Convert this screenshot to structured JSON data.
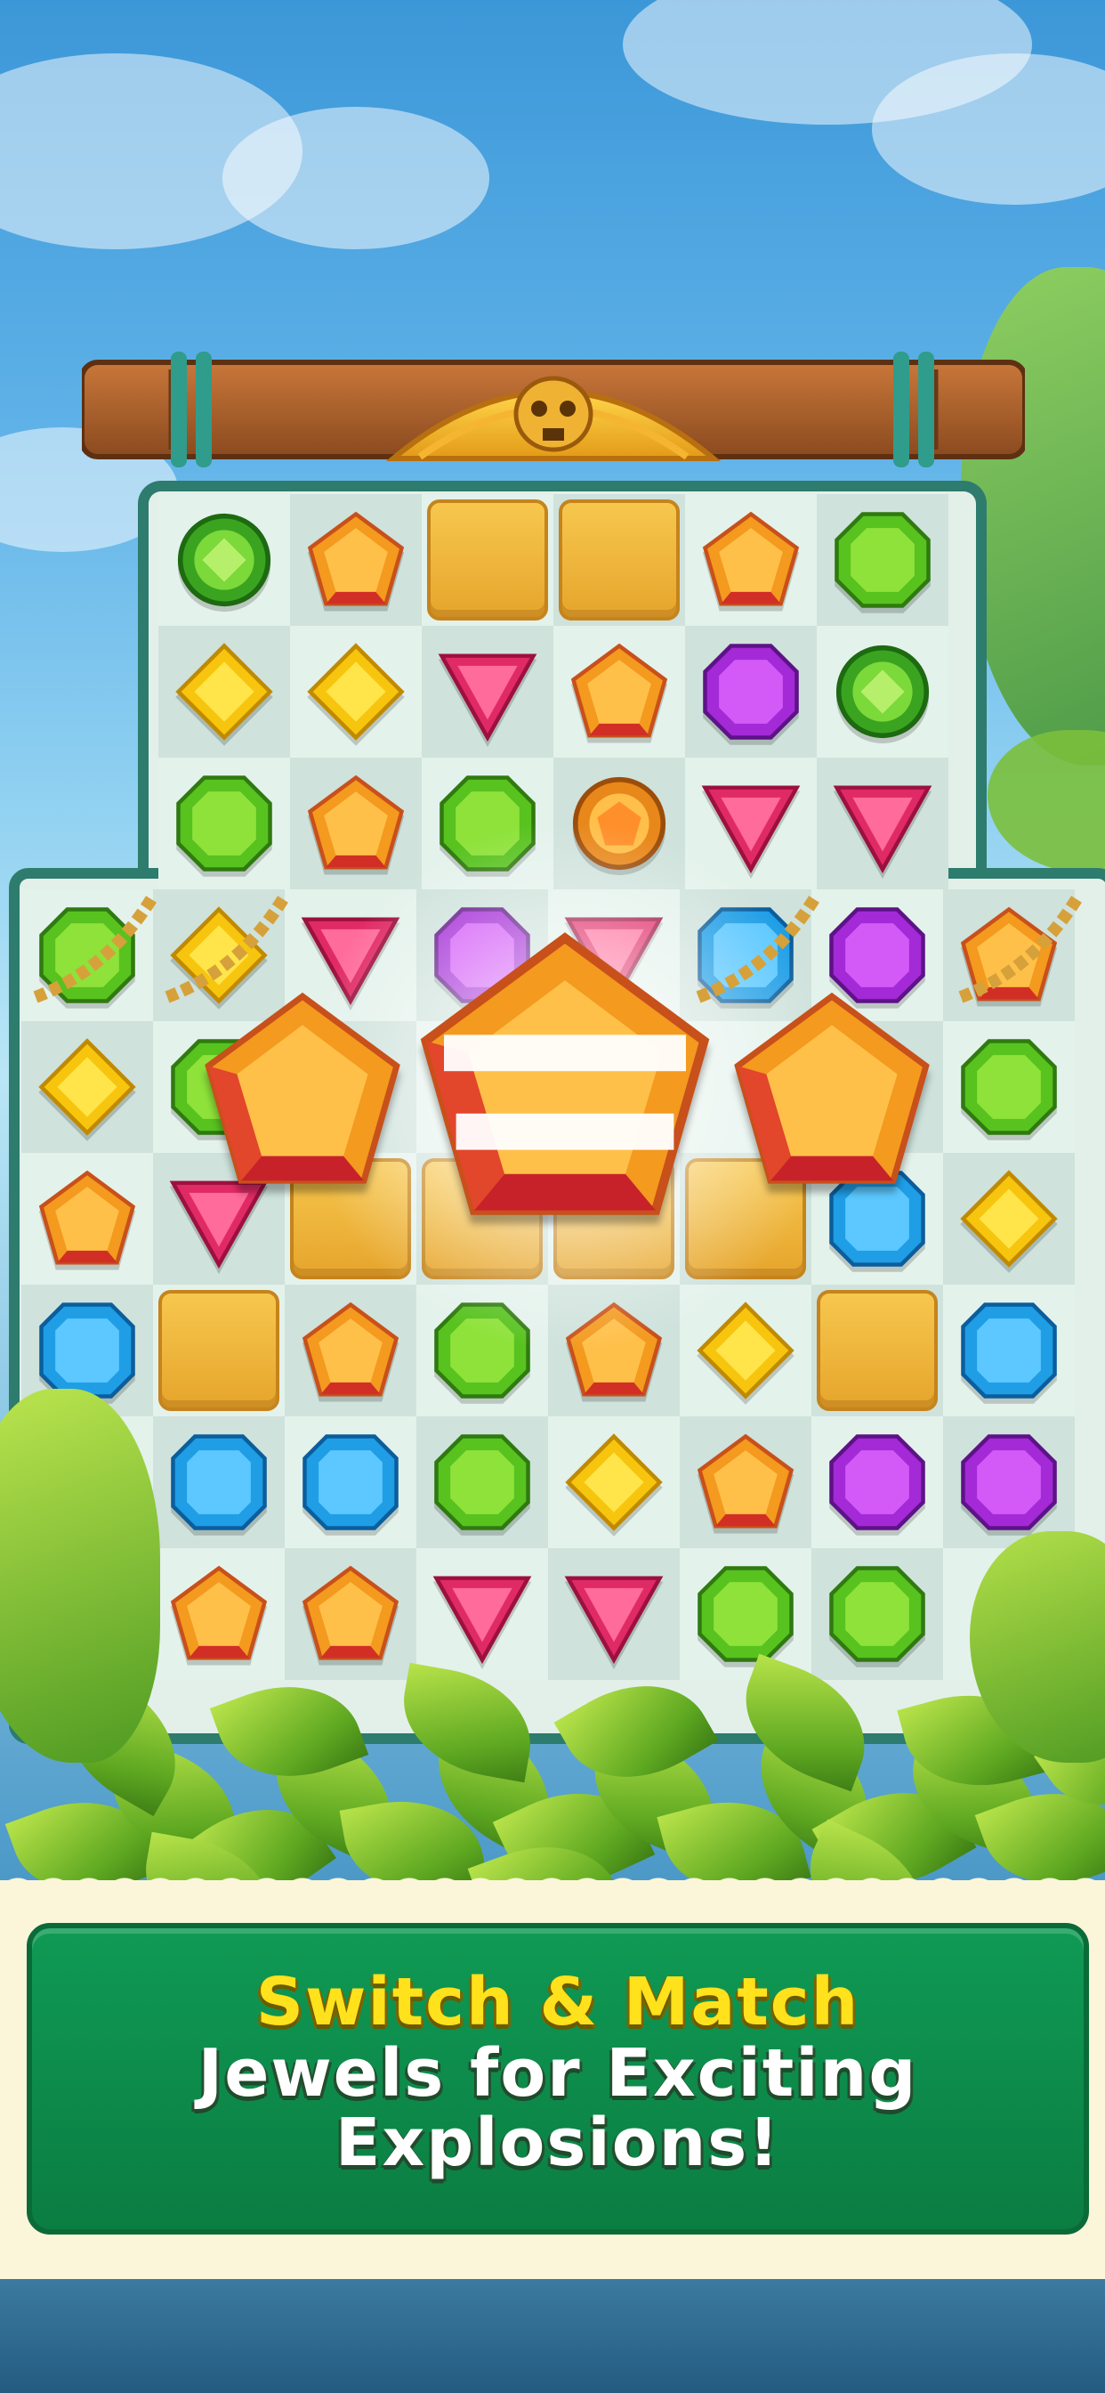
{
  "banner": {
    "line1": "Switch & Match",
    "line2": "Jewels for Exciting",
    "line3": "Explosions!"
  },
  "colors": {
    "headline_yellow": "#ffe11c",
    "banner_green": "#0f9a54",
    "board_border": "#2d7c6d"
  },
  "board": {
    "top_rows": [
      [
        "ring-green",
        "orange-pentagon",
        "block",
        "block",
        "orange-pentagon",
        "green-octagon"
      ],
      [
        "yellow-diamond",
        "yellow-diamond",
        "pink-triangle",
        "orange-pentagon",
        "purple-octagon",
        "ring-green"
      ],
      [
        "green-octagon",
        "orange-pentagon",
        "green-octagon",
        "ring-orange",
        "pink-triangle",
        "pink-triangle"
      ]
    ],
    "main_rows": [
      [
        "green-octagon",
        "yellow-diamond",
        "pink-triangle",
        "purple-octagon",
        "pink-triangle",
        "blue-octagon",
        "purple-octagon",
        "orange-pentagon"
      ],
      [
        "yellow-diamond",
        "green-octagon",
        "empty",
        "empty",
        "empty",
        "empty",
        "empty",
        "green-octagon"
      ],
      [
        "orange-pentagon",
        "pink-triangle",
        "block",
        "block",
        "block",
        "block",
        "blue-octagon",
        "yellow-diamond"
      ],
      [
        "blue-octagon",
        "block",
        "orange-pentagon",
        "green-octagon",
        "orange-pentagon",
        "yellow-diamond",
        "block",
        "blue-octagon"
      ],
      [
        "empty",
        "blue-octagon",
        "blue-octagon",
        "green-octagon",
        "yellow-diamond",
        "orange-pentagon",
        "purple-octagon",
        "purple-octagon"
      ],
      [
        "empty",
        "orange-pentagon",
        "orange-pentagon",
        "pink-triangle",
        "pink-triangle",
        "green-octagon",
        "green-octagon",
        "empty"
      ]
    ]
  }
}
